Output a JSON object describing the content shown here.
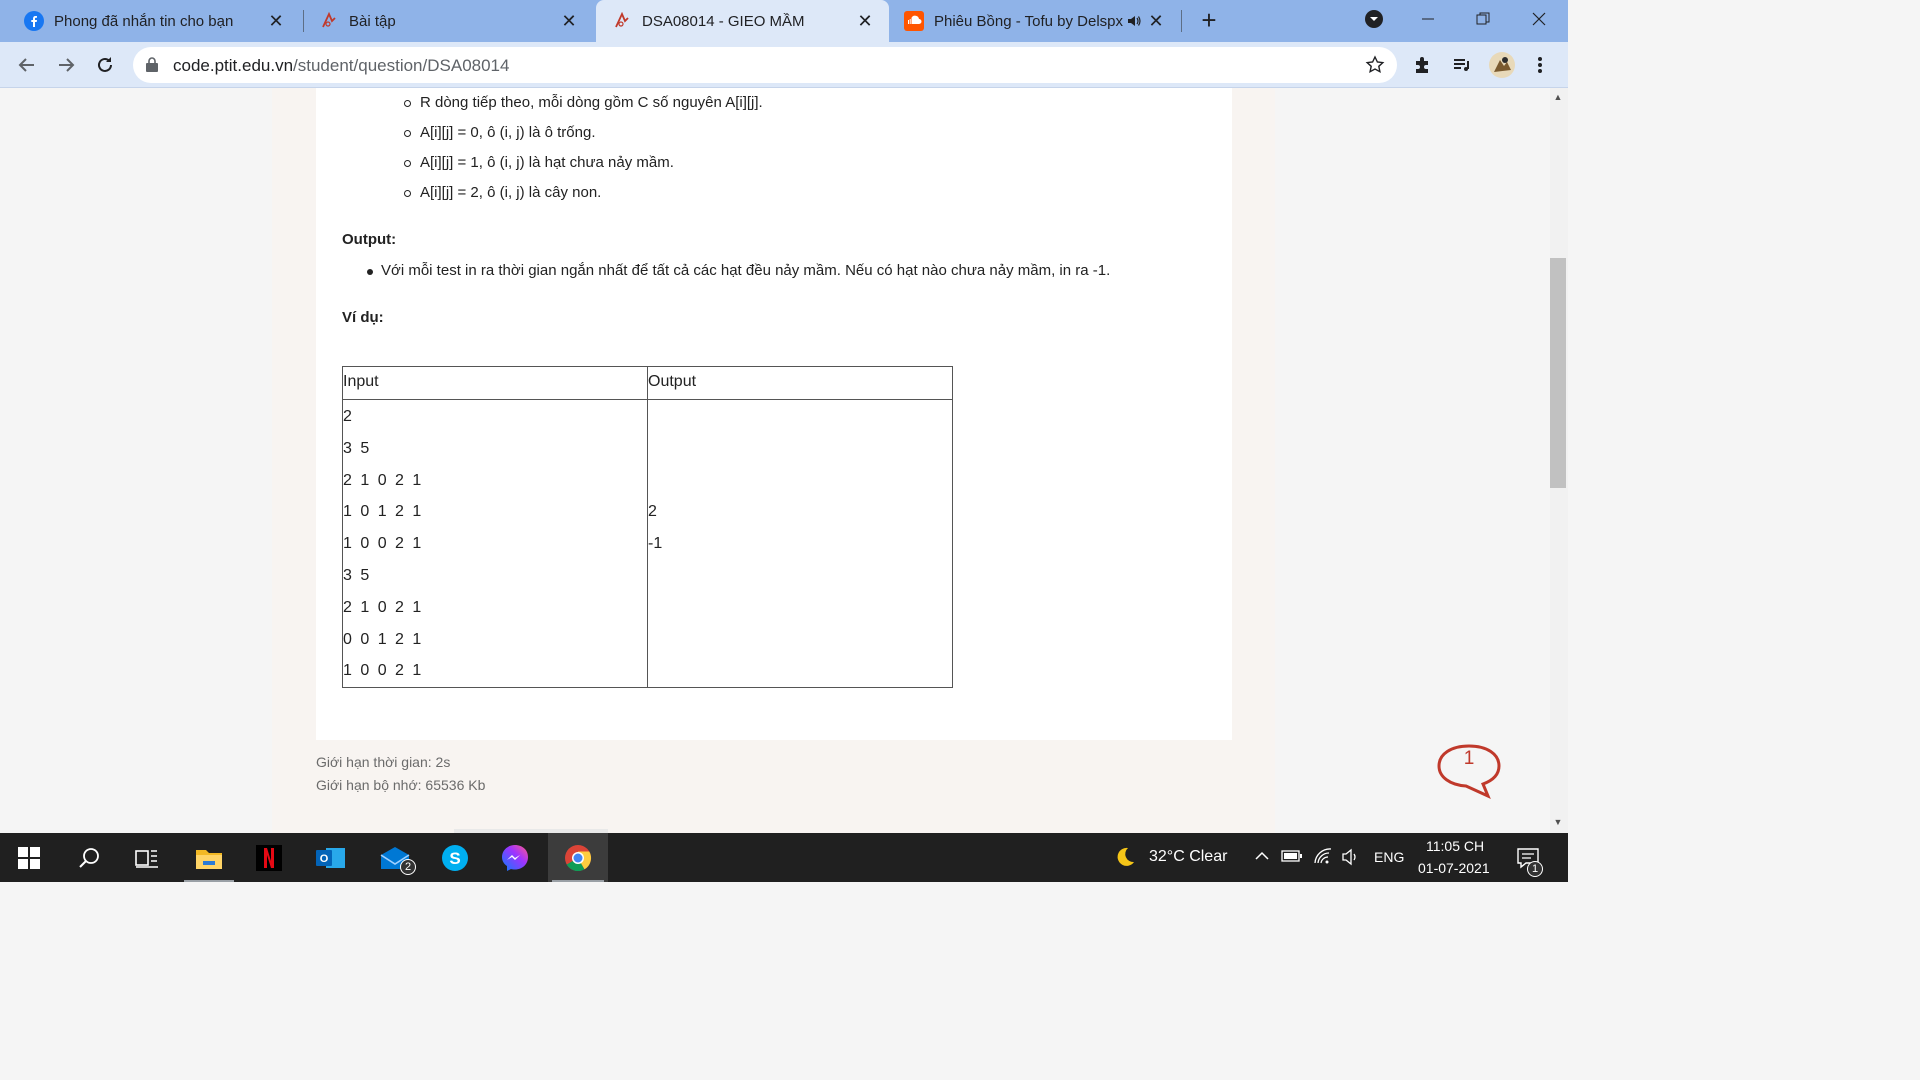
{
  "browser": {
    "tabs": [
      {
        "title": "Phong đã nhắn tin cho bạn",
        "icon": "facebook-icon"
      },
      {
        "title": "Bài tập",
        "icon": "ptit-icon"
      },
      {
        "title": "DSA08014 - GIEO MẦM",
        "icon": "ptit-icon",
        "active": true
      },
      {
        "title": "Phiêu Bồng - Tofu by Delspx",
        "icon": "soundcloud-icon",
        "audio": true
      }
    ],
    "url_host": "code.ptit.edu.vn",
    "url_path": "/student/question/DSA08014"
  },
  "problem": {
    "input_items": [
      "R dòng tiếp theo, mỗi dòng gồm C số nguyên A[i][j].",
      "A[i][j] = 0, ô (i, j) là ô trống.",
      "A[i][j] = 1, ô (i, j) là hạt chưa nảy mầm.",
      "A[i][j] = 2, ô (i, j) là cây non."
    ],
    "output_heading": "Output:",
    "output_items": [
      "Với mỗi test in ra thời gian ngắn nhất để tất cả các hạt đều nảy mầm. Nếu có hạt nào chưa nảy mầm, in ra -1."
    ],
    "example_heading": "Ví dụ:",
    "example_table": {
      "headers": [
        "Input",
        "Output"
      ],
      "input_lines": [
        "2",
        "3 5",
        "2 1 0 2 1",
        "1 0 1 2 1",
        "1 0 0 2 1",
        "3 5",
        "2 1 0 2 1",
        "0 0 1 2 1",
        "1 0 0 2 1"
      ],
      "output_lines": [
        "",
        "",
        "",
        "2",
        "-1",
        "",
        "",
        "",
        ""
      ]
    },
    "time_limit": "Giới hạn thời gian: 2s",
    "memory_limit": "Giới hạn bộ nhớ: 65536 Kb"
  },
  "chat_widget": {
    "count": "1"
  },
  "taskbar": {
    "apps": [
      "windows-start-icon",
      "search-icon",
      "task-view-icon",
      "file-explorer-icon",
      "netflix-icon",
      "outlook-icon",
      "mail-icon",
      "skype-icon",
      "messenger-icon",
      "chrome-icon"
    ],
    "mail_badge": "2",
    "weather": "32°C  Clear",
    "language": "ENG",
    "time": "11:05 CH",
    "date": "01-07-2021",
    "notification_count": "1"
  },
  "colors": {
    "tabbar": "#8fb3e8",
    "toolbar": "#dde8f8",
    "taskbar": "#202020",
    "chat_bubble": "#c0392b"
  }
}
